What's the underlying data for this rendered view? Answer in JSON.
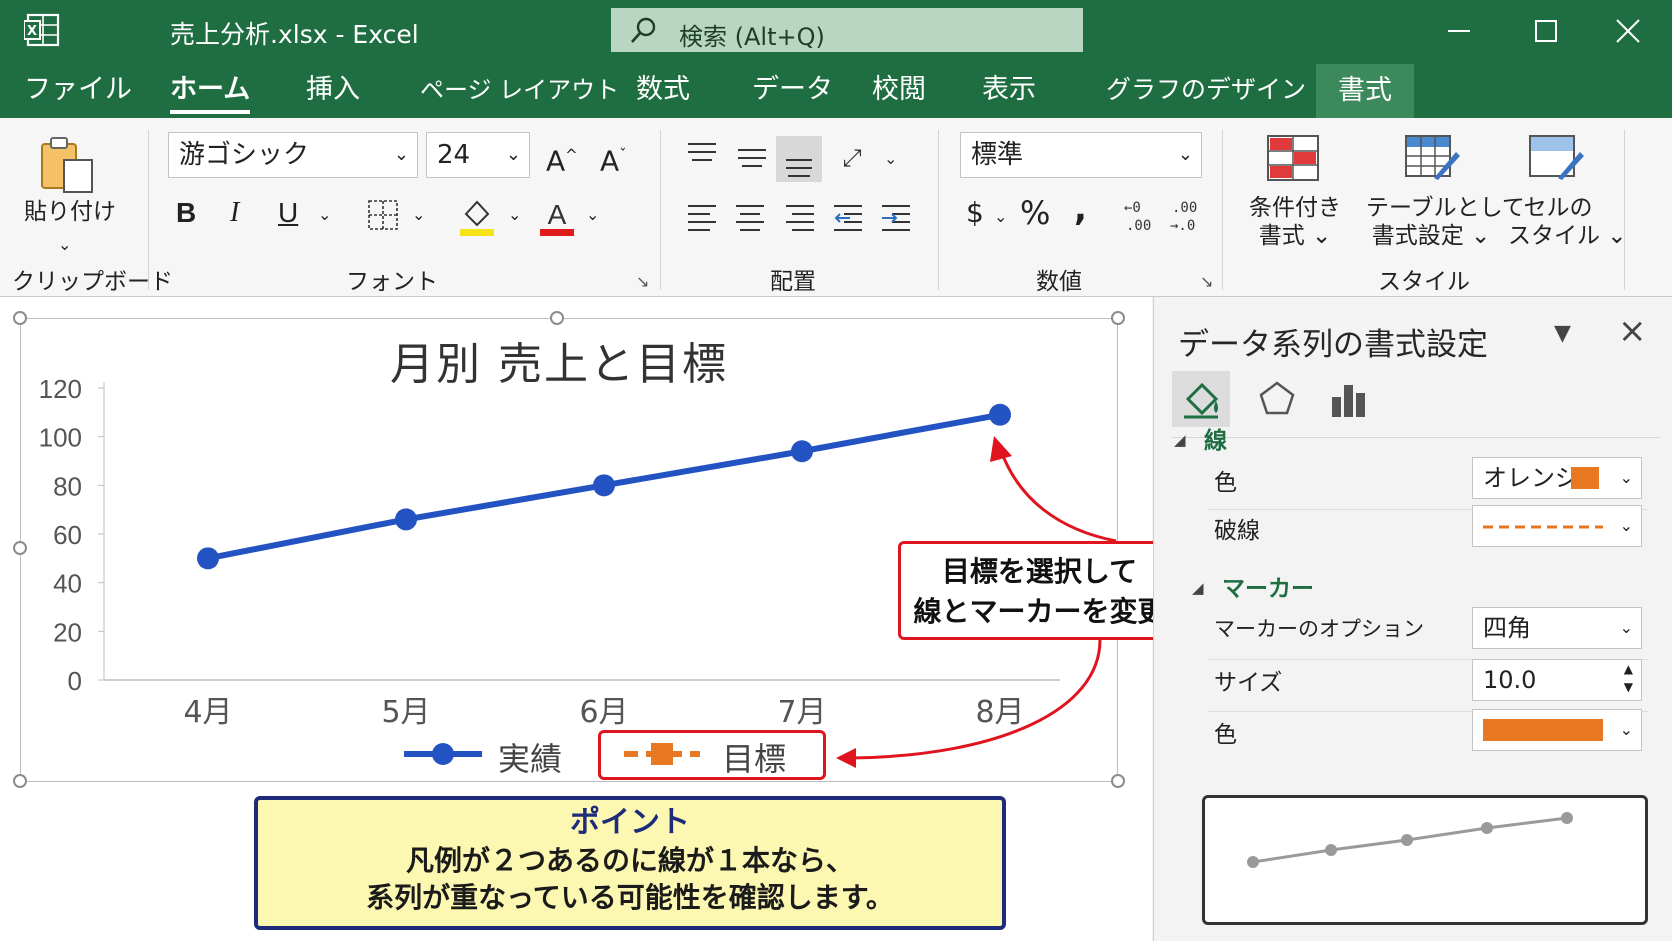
{
  "window": {
    "title": "売上分析.xlsx  -  Excel",
    "search_placeholder": "検索 (Alt+Q)"
  },
  "tabs": [
    {
      "label": "ファイル"
    },
    {
      "label": "ホーム"
    },
    {
      "label": "挿入"
    },
    {
      "label": "ページ レイアウト"
    },
    {
      "label": "数式"
    },
    {
      "label": "データ"
    },
    {
      "label": "校閲"
    },
    {
      "label": "表示"
    },
    {
      "label": "グラフのデザイン"
    },
    {
      "label": "書式"
    }
  ],
  "ribbon": {
    "clipboard": {
      "paste_label": "貼り付け",
      "group_label": "クリップボード"
    },
    "font": {
      "font_name": "游ゴシック",
      "font_size": "24",
      "group_label": "フォント"
    },
    "alignment": {
      "group_label": "配置"
    },
    "number": {
      "format": "標準",
      "group_label": "数値"
    },
    "styles": {
      "conditional_line1": "条件付き",
      "conditional_line2": "書式",
      "table_line1": "テーブルとして",
      "table_line2": "書式設定",
      "cell_line1": "セルの",
      "cell_line2": "スタイル",
      "group_label": "スタイル"
    }
  },
  "chart_data": {
    "type": "line",
    "title": "月別 売上と目標",
    "categories": [
      "4月",
      "5月",
      "6月",
      "7月",
      "8月"
    ],
    "ylim": [
      0,
      120
    ],
    "yticks": [
      "0",
      "20",
      "40",
      "60",
      "80",
      "100",
      "120"
    ],
    "series": [
      {
        "name": "実績",
        "values": [
          50,
          66,
          80,
          94,
          109
        ],
        "color": "#2353c2",
        "marker": "circle"
      },
      {
        "name": "目標",
        "values": [
          50,
          66,
          80,
          94,
          109
        ],
        "color": "#e87722",
        "marker": "square",
        "dashed": true
      }
    ],
    "legend": "bottom"
  },
  "annotations": {
    "callout_line1": "目標を選択して",
    "callout_line2": "線とマーカーを変更",
    "point_title": "ポイント",
    "point_line1": "凡例が２つあるのに線が１本なら、",
    "point_line2": "系列が重なっている可能性を確認します。",
    "accent_color": "#e0141e"
  },
  "pane": {
    "title": "データ系列の書式設定",
    "line_section": "線",
    "color_label": "色",
    "color_value": "オレンジ",
    "dash_label": "破線",
    "marker_section": "マーカー",
    "marker_option_label": "マーカーのオプション",
    "marker_option_value": "四角",
    "size_label": "サイズ",
    "size_value": "10.0",
    "marker_color_label": "色",
    "orange": "#e87722"
  }
}
